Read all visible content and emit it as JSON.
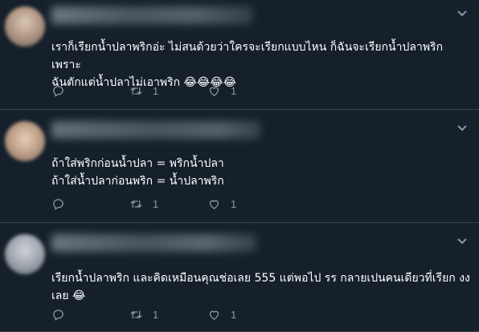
{
  "theme": {
    "background": "#15202b",
    "divider": "#38444d",
    "muted": "#8899a6",
    "text": "#ffffff"
  },
  "tweets": [
    {
      "text": "เราก็เรียกน้ำปลาพริกอ่ะ ไม่สนด้วยว่าใครจะเรียกแบบไหน ก็ฉันจะเรียกน้ำปลาพริก เพราะ\nฉันตักแต่น้ำปลาไม่เอาพริก 😂😂😂😂",
      "reply_count": "",
      "retweet_count": "1",
      "like_count": "1"
    },
    {
      "text": "ถ้าใส่พริกก่อนน้ำปลา = พริกน้ำปลา\nถ้าใส่น้ำปลาก่อนพริก = น้ำปลาพริก",
      "reply_count": "",
      "retweet_count": "1",
      "like_count": "1"
    },
    {
      "text": "เรียกน้ำปลาพริก และคิดเหมือนคุณช่อเลย 555 แต่พอไป รร กลายเปนคนเดียวที่เรียก งง\nเลย 😂",
      "reply_count": "",
      "retweet_count": "1",
      "like_count": "1"
    }
  ]
}
